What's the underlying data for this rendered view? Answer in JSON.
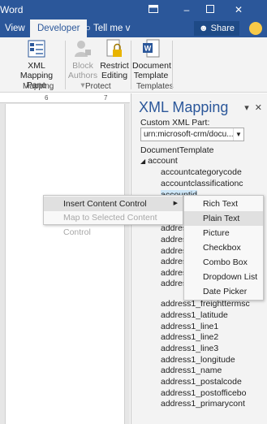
{
  "titlebar": {
    "title": "Word",
    "ribbon_display_icon": "ribbon-display-icon",
    "minimize_icon": "minimize-icon",
    "maximize_icon": "maximize-icon",
    "close_icon": "close-icon"
  },
  "tabs": {
    "view": "View",
    "developer": "Developer",
    "tell_me": "Tell me v",
    "share": "Share"
  },
  "ribbon": {
    "xml_mapping_pane_l1": "XML Mapping",
    "xml_mapping_pane_l2": "Pane",
    "mapping_group": "Mapping",
    "block_authors_l1": "Block",
    "block_authors_l2": "Authors",
    "restrict_editing_l1": "Restrict",
    "restrict_editing_l2": "Editing",
    "protect_group": "Protect",
    "document_template_l1": "Document",
    "document_template_l2": "Template",
    "templates_group": "Templates"
  },
  "ruler": {
    "mark6": "6",
    "mark7": "7"
  },
  "pane": {
    "title": "XML Mapping",
    "custom_xml_part_label": "Custom XML Part:",
    "custom_xml_part_value": "urn:microsoft-crm/docu...",
    "tree": [
      "DocumentTemplate",
      "account",
      "accountcategorycode",
      "accountclassificationc",
      "accountid",
      "address",
      "address",
      "address",
      "address",
      "address",
      "address",
      "address1_freighttermsc",
      "address1_latitude",
      "address1_line1",
      "address1_line2",
      "address1_line3",
      "address1_longitude",
      "address1_name",
      "address1_postalcode",
      "address1_postofficebo",
      "address1_primarycont"
    ]
  },
  "context_menu": {
    "insert_content_control": "Insert Content Control",
    "map_to_selected": "Map to Selected Content Control"
  },
  "submenu": {
    "rich_text": "Rich Text",
    "plain_text": "Plain Text",
    "picture": "Picture",
    "checkbox": "Checkbox",
    "combo_box": "Combo Box",
    "dropdown_list": "Dropdown List",
    "date_picker": "Date Picker"
  },
  "colors": {
    "accent": "#2b579a",
    "ribbon_bg": "#f3f3f3",
    "selection": "#cde6f7"
  }
}
